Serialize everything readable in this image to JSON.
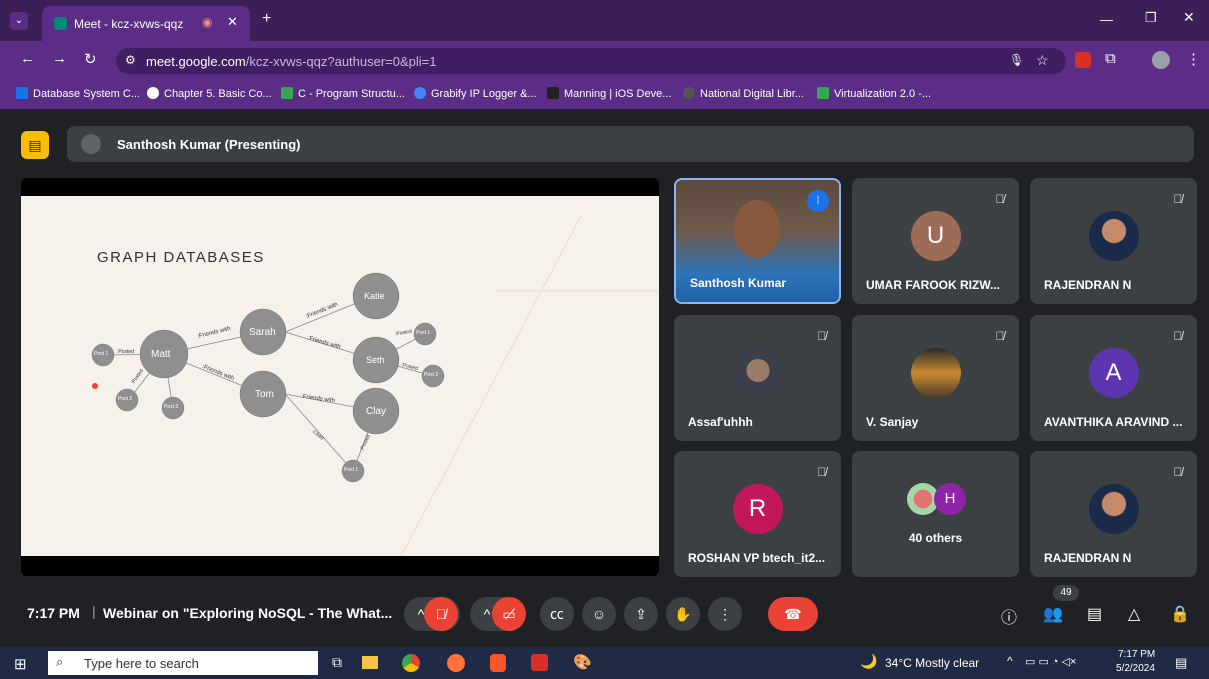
{
  "browser": {
    "tab_title": "Meet - kcz-xvws-qqz",
    "new_tab": "+",
    "url_domain": "meet.google.com",
    "url_path": "/kcz-xvws-qqz?authuser=0&pli=1",
    "bookmarks": [
      {
        "label": "Database System C...",
        "color": "#1a73e8"
      },
      {
        "label": "Chapter 5. Basic Co...",
        "color": "#ffffff"
      },
      {
        "label": "C - Program Structu...",
        "color": "#34a853"
      },
      {
        "label": "Grabify IP Logger &...",
        "color": "#4285f4"
      },
      {
        "label": "Manning | iOS Deve...",
        "color": "#222222"
      },
      {
        "label": "National Digital Libr...",
        "color": "#555555"
      },
      {
        "label": "Virtualization 2.0 -...",
        "color": "#34a853"
      }
    ]
  },
  "meet": {
    "presenter_label": "Santhosh Kumar (Presenting)",
    "slide": {
      "title": "GRAPH DATABASES",
      "nodes": [
        "Matt",
        "Sarah",
        "Tom",
        "Katie",
        "Seth",
        "Clay",
        "Post 1",
        "Post 2",
        "Post 3",
        "Post 1",
        "Post 2",
        "Post 1"
      ],
      "edges": [
        ":Friends with",
        ":Friends with",
        ":Friends with",
        ":Friends with",
        ":Friends with",
        ":Posted",
        ":Posted",
        ":Posted",
        ":Posted",
        ":Posted",
        ":Liked"
      ]
    },
    "tiles": [
      {
        "name": "Santhosh Kumar"
      },
      {
        "name": "UMAR FAROOK RIZW...",
        "initial": "U",
        "color": "#9e6b57"
      },
      {
        "name": "RAJENDRAN N"
      },
      {
        "name": "Assaf'uhhh"
      },
      {
        "name": "V. Sanjay"
      },
      {
        "name": "AVANTHIKA ARAVIND ...",
        "initial": "A",
        "color": "#5e35b1"
      },
      {
        "name": "ROSHAN VP btech_it2...",
        "initial": "R",
        "color": "#c2185b"
      },
      {
        "name": "40 others",
        "initial": "H",
        "color": "#8e24aa"
      },
      {
        "name": "RAJENDRAN N"
      }
    ],
    "time": "7:17 PM",
    "meeting_title": "Webinar on \"Exploring NoSQL - The What...",
    "participants_count": "49"
  },
  "taskbar": {
    "search_placeholder": "Type here to search",
    "weather": "34°C  Mostly clear",
    "clock_time": "7:17 PM",
    "clock_date": "5/2/2024"
  }
}
